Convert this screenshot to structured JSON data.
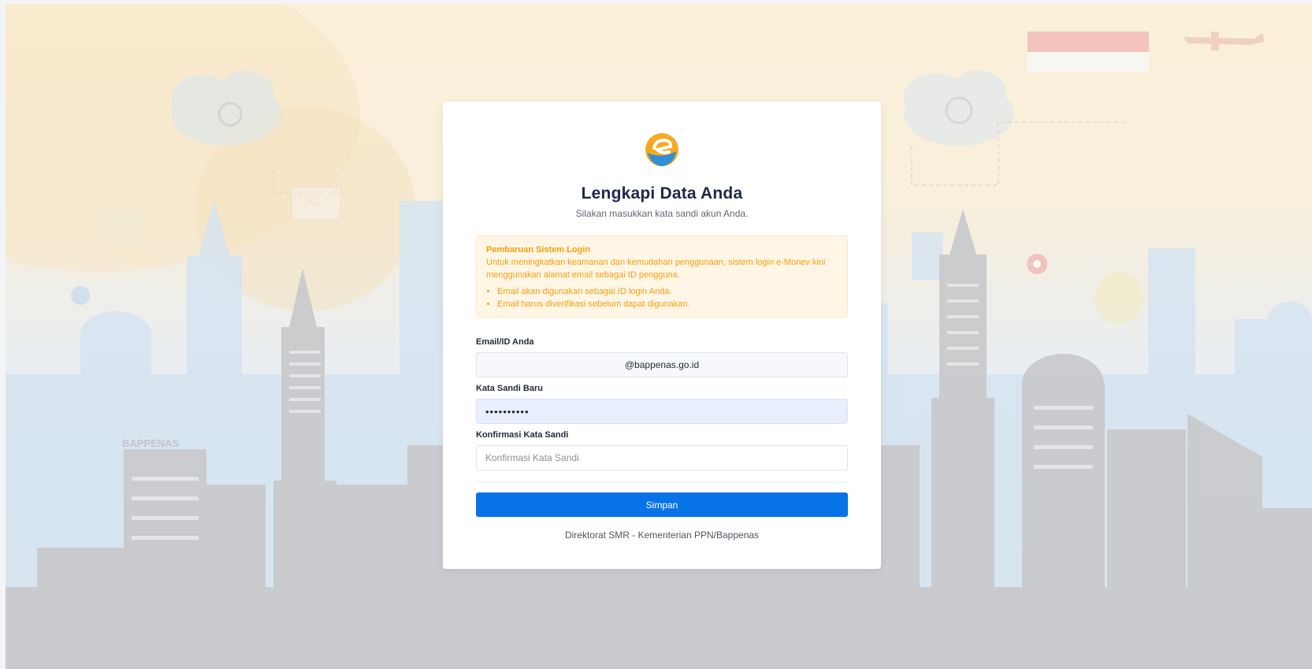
{
  "background": {
    "watermark_text": "BAPPENAS"
  },
  "card": {
    "logo_icon": "e-monev-logo-icon",
    "title": "Lengkapi Data Anda",
    "subtitle": "Silakan masukkan kata sandi akun Anda.",
    "notice": {
      "title": "Pembaruan Sistem Login",
      "body": "Untuk meningkatkan keamanan dan kemudahan penggunaan, sistem login e-Monev kini menggunakan alamat email sebagai ID pengguna.",
      "items": [
        "Email akan digunakan sebagai ID login Anda.",
        "Email harus diverifikasi sebelum dapat digunakan."
      ]
    },
    "form": {
      "email_label": "Email/ID Anda",
      "email_value": "@bappenas.go.id",
      "password_label": "Kata Sandi Baru",
      "password_value": "••••••••••",
      "confirm_label": "Konfirmasi Kata Sandi",
      "confirm_placeholder": "Konfirmasi Kata Sandi",
      "submit_label": "Simpan"
    },
    "footer": "Direktorat SMR - Kementerian PPN/Bappenas"
  },
  "colors": {
    "primary": "#0873e6",
    "notice_text": "#f59e0b",
    "notice_bg": "#fff6e6",
    "title": "#1f2747"
  }
}
